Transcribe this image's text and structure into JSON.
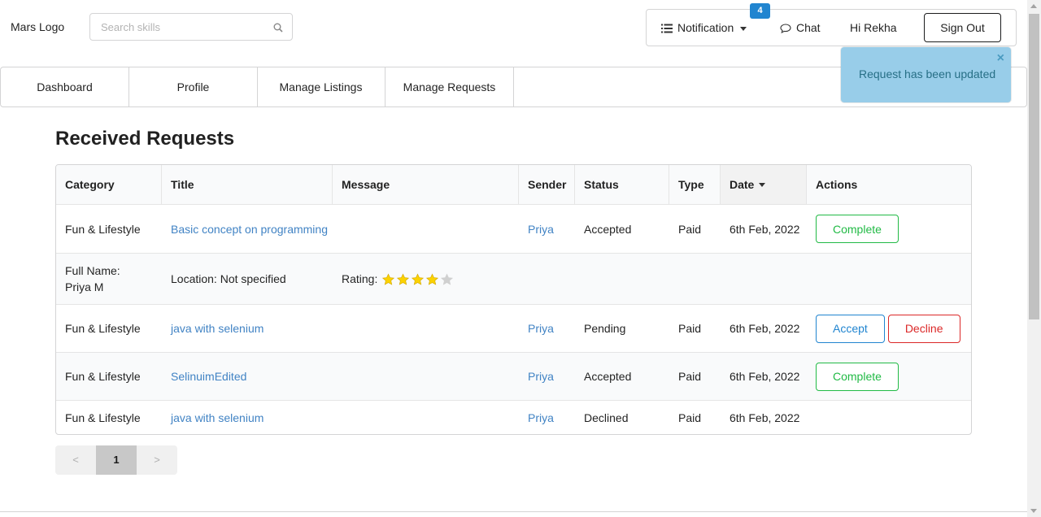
{
  "header": {
    "logo": "Mars Logo",
    "search_placeholder": "Search skills",
    "notification_label": "Notification",
    "notification_count": "4",
    "chat_label": "Chat",
    "greeting": "Hi Rekha",
    "signout_label": "Sign Out"
  },
  "tabs": [
    "Dashboard",
    "Profile",
    "Manage Listings",
    "Manage Requests"
  ],
  "toast": {
    "message": "Request has been updated",
    "close": "×"
  },
  "page_title": "Received Requests",
  "table": {
    "columns": [
      "Category",
      "Title",
      "Message",
      "Sender",
      "Status",
      "Type",
      "Date",
      "Actions"
    ],
    "rows": [
      {
        "category": "Fun & Lifestyle",
        "title": "Basic concept on programming",
        "message": "",
        "sender": "Priya",
        "status": "Accepted",
        "type": "Paid",
        "date": "6th Feb, 2022",
        "actions": [
          "Complete"
        ]
      },
      {
        "category": "Fun & Lifestyle",
        "title": "java with selenium",
        "message": "",
        "sender": "Priya",
        "status": "Pending",
        "type": "Paid",
        "date": "6th Feb, 2022",
        "actions": [
          "Accept",
          "Decline"
        ]
      },
      {
        "category": "Fun & Lifestyle",
        "title": "SelinuimEdited",
        "message": "",
        "sender": "Priya",
        "status": "Accepted",
        "type": "Paid",
        "date": "6th Feb, 2022",
        "actions": [
          "Complete"
        ]
      },
      {
        "category": "Fun & Lifestyle",
        "title": "java with selenium",
        "message": "",
        "sender": "Priya",
        "status": "Declined",
        "type": "Paid",
        "date": "6th Feb, 2022",
        "actions": []
      }
    ],
    "detail": {
      "full_name_label": "Full Name:",
      "full_name": "Priya M",
      "location": "Location: Not specified",
      "rating_label": "Rating:",
      "rating": 4,
      "rating_max": 5
    }
  },
  "pagination": {
    "prev": "<",
    "current": "1",
    "next": ">"
  },
  "colors": {
    "accent": "#2185d0",
    "green": "#21ba45",
    "red": "#db2828",
    "link": "#4183c4",
    "toast_bg": "#98cde9",
    "star": "#fbd200"
  }
}
